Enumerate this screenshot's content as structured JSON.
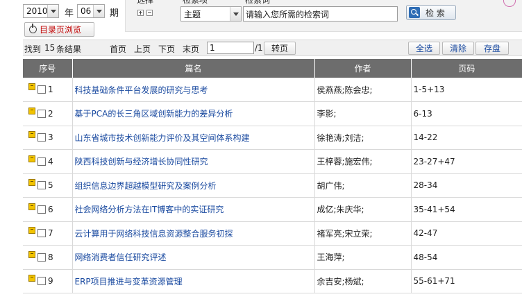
{
  "date": {
    "year": "2010",
    "year_label": "年",
    "issue": "06",
    "issue_label": "期"
  },
  "toc_button": "目录页浏览",
  "search": {
    "label_scope_partial": "选择",
    "label_field_partial": "检索项",
    "label_keyword_partial": "检索词",
    "field_value": "主题",
    "keyword_value": "请输入您所需的检索词",
    "button_label": "检 索"
  },
  "toolbar": {
    "found_prefix": "找到",
    "found_count": "15",
    "found_suffix": "条结果",
    "first_page": "首页",
    "prev_page": "上页",
    "next_page": "下页",
    "last_page": "末页",
    "page_value": "1",
    "page_total": "/1",
    "goto_button": "转页",
    "select_all": "全选",
    "clear": "清除",
    "save": "存盘"
  },
  "table": {
    "headers": [
      "序号",
      "篇名",
      "作者",
      "页码"
    ],
    "rows": [
      {
        "num": "1",
        "title": "科技基础条件平台发展的研究与思考",
        "author": "侯燕燕;陈会忠;",
        "pages": "1-5+13"
      },
      {
        "num": "2",
        "title": "基于PCA的长三角区域创新能力的差异分析",
        "author": "李影;",
        "pages": "6-13"
      },
      {
        "num": "3",
        "title": "山东省城市技术创新能力评价及其空间体系构建",
        "author": "徐艳涛;刘洁;",
        "pages": "14-22"
      },
      {
        "num": "4",
        "title": "陕西科技创新与经济增长协同性研究",
        "author": "王梓蓉;施宏伟;",
        "pages": "23-27+47"
      },
      {
        "num": "5",
        "title": "组织信息边界超越模型研究及案例分析",
        "author": "胡广伟;",
        "pages": "28-34"
      },
      {
        "num": "6",
        "title": "社会网络分析方法在IT博客中的实证研究",
        "author": "成亿;朱庆华;",
        "pages": "35-41+54"
      },
      {
        "num": "7",
        "title": "云计算用于网络科技信息资源整合服务初探",
        "author": "褚军亮;宋立荣;",
        "pages": "42-47"
      },
      {
        "num": "8",
        "title": "网络消费者信任研究评述",
        "author": "王海萍;",
        "pages": "48-54"
      },
      {
        "num": "9",
        "title": "ERP项目推进与变革资源管理",
        "author": "余吉安;杨斌;",
        "pages": "55-61+71"
      }
    ]
  }
}
